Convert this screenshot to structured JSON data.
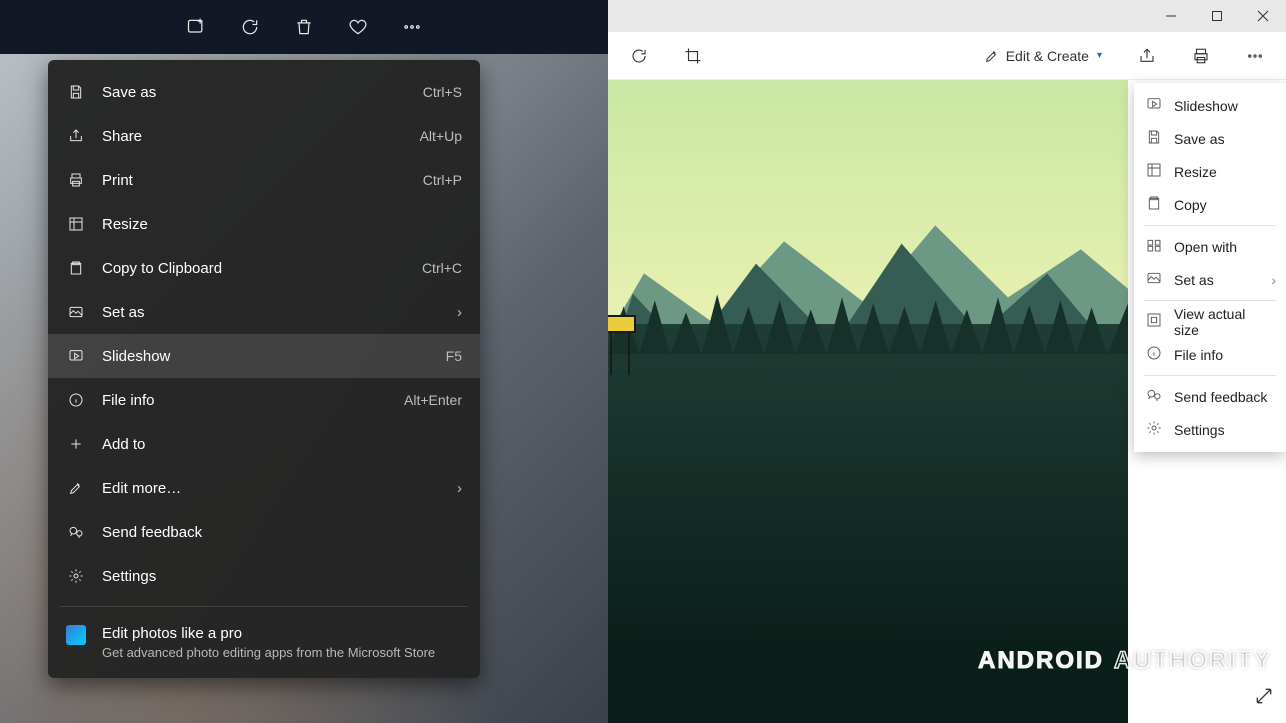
{
  "dark_toolbar": {
    "icons": [
      "image-plus",
      "rotate",
      "trash",
      "heart",
      "more"
    ]
  },
  "dark_menu": {
    "items": [
      {
        "icon": "save",
        "label": "Save as",
        "shortcut": "Ctrl+S",
        "hover": false
      },
      {
        "icon": "share",
        "label": "Share",
        "shortcut": "Alt+Up",
        "hover": false
      },
      {
        "icon": "print",
        "label": "Print",
        "shortcut": "Ctrl+P",
        "hover": false
      },
      {
        "icon": "resize",
        "label": "Resize",
        "shortcut": "",
        "hover": false
      },
      {
        "icon": "clipboard",
        "label": "Copy to Clipboard",
        "shortcut": "Ctrl+C",
        "hover": false
      },
      {
        "icon": "setas",
        "label": "Set as",
        "shortcut": "",
        "chevron": true,
        "hover": false
      },
      {
        "icon": "slideshow",
        "label": "Slideshow",
        "shortcut": "F5",
        "hover": true
      },
      {
        "icon": "fileinfo",
        "label": "File info",
        "shortcut": "Alt+Enter",
        "hover": false
      },
      {
        "icon": "addto",
        "label": "Add to",
        "shortcut": "",
        "hover": false
      },
      {
        "icon": "editmore",
        "label": "Edit more…",
        "shortcut": "",
        "chevron": true,
        "hover": false
      },
      {
        "icon": "feedback",
        "label": "Send feedback",
        "shortcut": "",
        "hover": false
      },
      {
        "icon": "settings",
        "label": "Settings",
        "shortcut": "",
        "hover": false
      }
    ],
    "promo": {
      "title": "Edit photos like a pro",
      "subtitle": "Get advanced photo editing apps from the Microsoft Store"
    }
  },
  "light_toolbar": {
    "rotate": "rotate",
    "crop": "crop",
    "edit_create_label": "Edit & Create",
    "share": "share",
    "print_icon": "print",
    "more": "more"
  },
  "light_menu": {
    "items": [
      {
        "icon": "slideshow",
        "label": "Slideshow"
      },
      {
        "icon": "save",
        "label": "Save as"
      },
      {
        "icon": "resize",
        "label": "Resize"
      },
      {
        "icon": "clipboard",
        "label": "Copy"
      },
      {
        "sep": true
      },
      {
        "icon": "openwith",
        "label": "Open with"
      },
      {
        "icon": "setas",
        "label": "Set as",
        "chevron": true
      },
      {
        "sep": true
      },
      {
        "icon": "viewactual",
        "label": "View actual size"
      },
      {
        "icon": "fileinfo",
        "label": "File info"
      },
      {
        "sep": true
      },
      {
        "icon": "feedback",
        "label": "Send feedback"
      },
      {
        "icon": "settings",
        "label": "Settings"
      }
    ]
  },
  "watermark": {
    "a": "ANDROID",
    "b": "AUTHORITY"
  }
}
